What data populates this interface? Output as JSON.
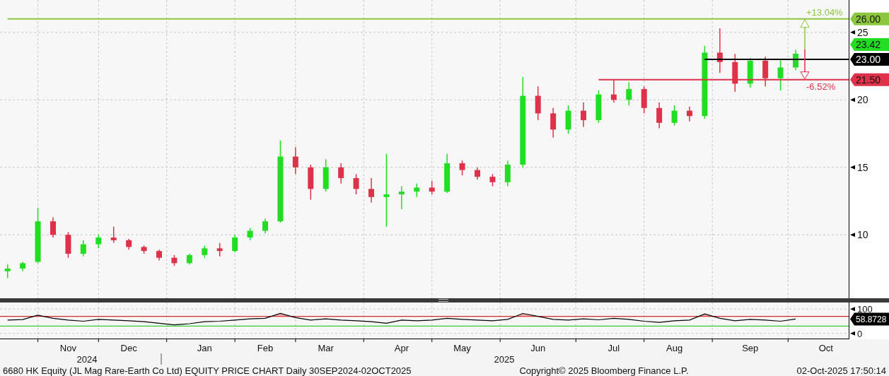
{
  "price_chart": {
    "chart_data": {
      "type": "candlestick",
      "grid": true,
      "ylim": [
        5.3,
        27.4
      ],
      "yticks": [
        10,
        15,
        20,
        25
      ],
      "categories": [
        null,
        null,
        null,
        null,
        null,
        null,
        null,
        null,
        null,
        null,
        null,
        null,
        null,
        null,
        null,
        null,
        null,
        null,
        null,
        null,
        null,
        null,
        null,
        null,
        null,
        null,
        null,
        null,
        null,
        null,
        null,
        null,
        null,
        null,
        null,
        null,
        null,
        null,
        null,
        null,
        null,
        null,
        null,
        null,
        null,
        null,
        null,
        null,
        null,
        null,
        null,
        null,
        null,
        null,
        null,
        null
      ],
      "ohlc": [
        [
          7.3,
          7.8,
          6.8,
          7.5
        ],
        [
          7.5,
          8.0,
          7.3,
          7.9
        ],
        [
          8.0,
          12.0,
          7.9,
          11.0
        ],
        [
          11.0,
          11.3,
          9.8,
          10.0
        ],
        [
          10.0,
          10.2,
          8.3,
          8.6
        ],
        [
          8.6,
          9.6,
          8.4,
          9.3
        ],
        [
          9.3,
          10.0,
          9.0,
          9.8
        ],
        [
          9.8,
          10.6,
          9.4,
          9.6
        ],
        [
          9.6,
          9.7,
          8.9,
          9.1
        ],
        [
          9.1,
          9.2,
          8.6,
          8.8
        ],
        [
          8.8,
          8.9,
          8.1,
          8.3
        ],
        [
          8.3,
          8.5,
          7.7,
          7.9
        ],
        [
          7.9,
          8.6,
          7.8,
          8.5
        ],
        [
          8.5,
          9.2,
          8.3,
          9.0
        ],
        [
          9.0,
          9.4,
          8.4,
          8.8
        ],
        [
          8.8,
          10.0,
          8.7,
          9.8
        ],
        [
          9.8,
          10.5,
          9.6,
          10.3
        ],
        [
          10.3,
          11.2,
          10.1,
          11.0
        ],
        [
          11.0,
          17.0,
          10.9,
          15.8
        ],
        [
          15.8,
          16.5,
          14.5,
          15.0
        ],
        [
          15.0,
          15.2,
          12.6,
          13.4
        ],
        [
          13.4,
          15.6,
          13.2,
          15.0
        ],
        [
          15.0,
          15.3,
          13.8,
          14.2
        ],
        [
          14.2,
          14.5,
          13.0,
          13.4
        ],
        [
          13.4,
          14.2,
          12.4,
          12.8
        ],
        [
          12.8,
          16.0,
          10.6,
          13.0
        ],
        [
          13.0,
          13.6,
          11.9,
          13.2
        ],
        [
          13.2,
          13.8,
          12.8,
          13.5
        ],
        [
          13.5,
          14.0,
          13.0,
          13.2
        ],
        [
          13.2,
          16.0,
          13.1,
          15.3
        ],
        [
          15.3,
          15.5,
          14.4,
          14.8
        ],
        [
          14.8,
          15.0,
          14.1,
          14.3
        ],
        [
          14.3,
          14.5,
          13.6,
          13.9
        ],
        [
          13.9,
          15.5,
          13.6,
          15.2
        ],
        [
          15.2,
          21.7,
          15.0,
          20.3
        ],
        [
          20.3,
          21.0,
          18.5,
          19.0
        ],
        [
          19.0,
          19.4,
          17.2,
          17.8
        ],
        [
          17.8,
          19.6,
          17.5,
          19.2
        ],
        [
          19.2,
          19.8,
          18.0,
          18.5
        ],
        [
          18.5,
          20.7,
          18.3,
          20.4
        ],
        [
          20.4,
          21.5,
          19.8,
          20.0
        ],
        [
          20.0,
          21.3,
          19.6,
          20.8
        ],
        [
          20.8,
          21.0,
          19.0,
          19.4
        ],
        [
          19.4,
          19.8,
          17.9,
          18.3
        ],
        [
          18.3,
          19.6,
          18.1,
          19.2
        ],
        [
          19.2,
          19.5,
          18.4,
          18.8
        ],
        [
          18.8,
          24.0,
          18.6,
          23.5
        ],
        [
          23.5,
          25.3,
          22.0,
          22.8
        ],
        [
          22.8,
          23.4,
          20.6,
          21.2
        ],
        [
          21.2,
          23.1,
          20.9,
          22.9
        ],
        [
          22.9,
          23.2,
          21.0,
          21.6
        ],
        [
          21.6,
          23.0,
          20.7,
          22.4
        ],
        [
          22.4,
          23.7,
          22.2,
          23.42
        ],
        null,
        null,
        null
      ],
      "ref_lines": [
        {
          "axis": "y",
          "value": 26,
          "label": "26.00",
          "color": "#8cc63f"
        },
        {
          "axis": "y",
          "value": 23,
          "label": "23.00",
          "color": "#000000"
        },
        {
          "axis": "y",
          "value": 21.5,
          "label": "21.50",
          "color": "#e0314b"
        }
      ],
      "annotations": [
        "23.42",
        "+13.04%",
        "-6.52%"
      ]
    }
  },
  "rsi_chart": {
    "chart_data": {
      "type": "line",
      "grid": true,
      "ylim": [
        -24,
        127
      ],
      "yticks": [
        0,
        100
      ],
      "categories": [
        null,
        null,
        null,
        null,
        "Nov",
        null,
        null,
        null,
        "Dec",
        null,
        null,
        null,
        null,
        "Jan",
        null,
        null,
        null,
        "Feb",
        null,
        null,
        null,
        "Mar",
        null,
        null,
        null,
        null,
        "Apr",
        null,
        null,
        null,
        "May",
        null,
        null,
        null,
        null,
        "Jun",
        null,
        null,
        null,
        null,
        "Jul",
        null,
        null,
        null,
        "Aug",
        null,
        null,
        null,
        null,
        "Sep",
        null,
        null,
        null,
        null,
        "Oct",
        null
      ],
      "values": [
        55,
        57,
        75,
        62,
        55,
        50,
        58,
        55,
        52,
        48,
        42,
        35,
        40,
        48,
        50,
        55,
        60,
        62,
        82,
        65,
        55,
        60,
        55,
        52,
        48,
        42,
        55,
        52,
        55,
        62,
        58,
        55,
        52,
        58,
        82,
        70,
        58,
        55,
        60,
        56,
        62,
        58,
        50,
        45,
        52,
        55,
        80,
        62,
        52,
        58,
        55,
        50,
        59,
        null,
        null,
        null
      ],
      "ref_lines": [
        {
          "axis": "y",
          "value": 70,
          "color": "#cc2222"
        },
        {
          "axis": "y",
          "value": 30,
          "color": "#33cc33"
        }
      ],
      "annotations": [
        "58.8728"
      ]
    }
  },
  "x_axis": {
    "years": [
      "2024",
      "2025"
    ]
  },
  "footer": {
    "title": "6680 HK Equity (JL Mag Rare-Earth Co Ltd) EQUITY PRICE CHART Daily 30SEP2024-02OCT2025",
    "copyright": "Copyright© 2025 Bloomberg Finance L.P.",
    "timestamp": "02-Oct-2025 17:50:14"
  }
}
